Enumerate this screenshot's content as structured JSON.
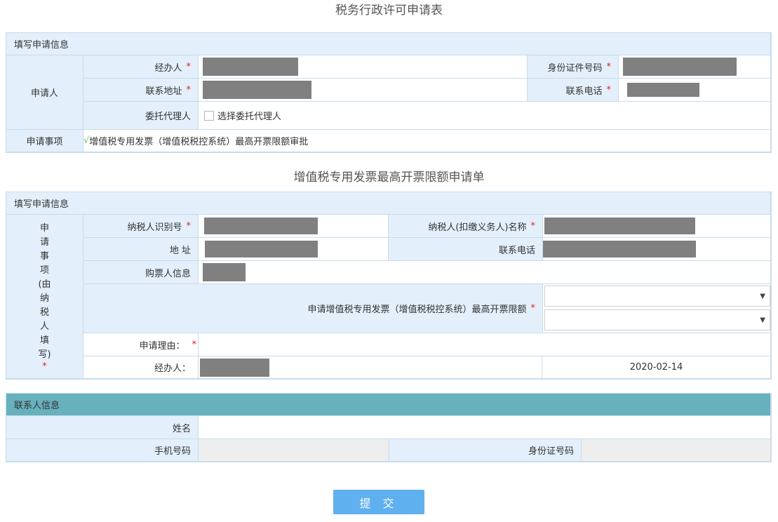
{
  "form": {
    "title": "税务行政许可申请表",
    "section1": {
      "header": "填写申请信息",
      "applicant_label": "申请人",
      "handler_label": "经办人",
      "id_label": "身份证件号码",
      "address_label": "联系地址",
      "phone_label": "联系电话",
      "agent_label": "委托代理人",
      "agent_checkbox_label": "选择委托代理人",
      "agent_checked": false,
      "matter_label": "申请事项",
      "matter_tick": "√",
      "matter_value": "增值税专用发票（增值税税控系统）最高开票限额审批",
      "required_mark": "*"
    }
  },
  "limit_form": {
    "title": "增值税专用发票最高开票限额申请单",
    "section2": {
      "header": "填写申请信息",
      "side_label": "申请事项(由纳税人填写)",
      "required_mark": "*",
      "taxpayer_id_label": "纳税人识别号",
      "taxpayer_name_label": "纳税人(扣缴义务人)名称",
      "address_label": "地 址",
      "phone_label": "联系电话",
      "buyer_info_label": "购票人信息",
      "limit_label": "申请增值税专用发票（增值税税控系统）最高开票限额",
      "limit_select_1": "",
      "limit_select_2": "",
      "reason_label": "申请理由：",
      "reason_value": "",
      "handler_label": "经办人：",
      "date": "2020-02-14"
    }
  },
  "contact": {
    "header": "联系人信息",
    "name_label": "姓名",
    "name_value": "",
    "mobile_label": "手机号码",
    "mobile_value": "",
    "idcard_label": "身份证号码",
    "idcard_value": ""
  },
  "actions": {
    "submit_label": "提 交"
  },
  "colors": {
    "label_bg": "#e3effa",
    "border": "#c7dcec",
    "teal_header": "#67b1bd",
    "submit_bg": "#5fb0ef",
    "required": "#e0261d",
    "redaction": "#808080"
  }
}
